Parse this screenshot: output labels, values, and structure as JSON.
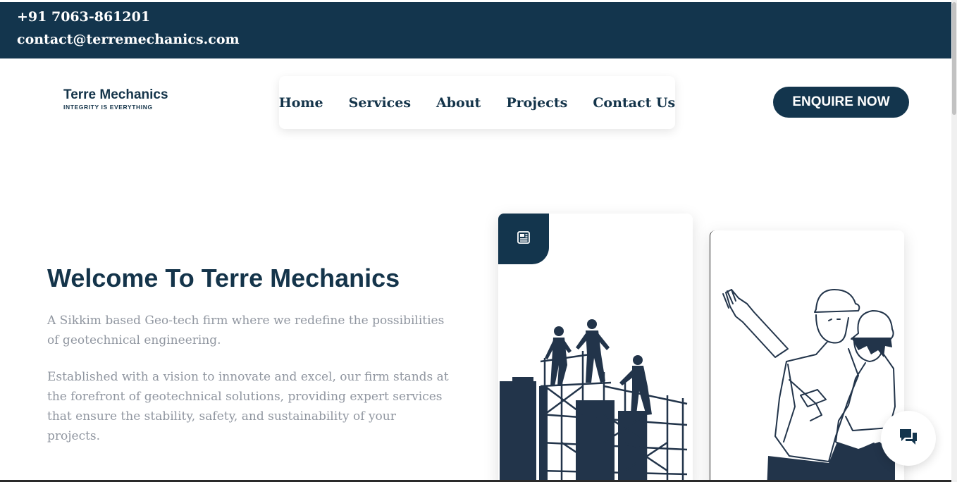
{
  "topbar": {
    "phone": "+91 7063-861201",
    "email": "contact@terremechanics.com"
  },
  "logo": {
    "name": "Terre Mechanics",
    "tagline": "Integrity is Everything"
  },
  "nav": {
    "items": [
      {
        "label": "Home"
      },
      {
        "label": "Services"
      },
      {
        "label": "About"
      },
      {
        "label": "Projects"
      },
      {
        "label": "Contact Us"
      }
    ]
  },
  "cta": {
    "label": "ENQUIRE NOW"
  },
  "hero": {
    "title": "Welcome To Terre Mechanics",
    "paragraph1": "A Sikkim based Geo-tech firm where we redefine the possibilities of geotechnical engineering.",
    "paragraph2": "Established with a vision to innovate and excel, our firm stands at the forefront of geotechnical solutions, providing expert services that ensure the stability, safety, and sustainability of your projects."
  },
  "icons": {
    "badge": "newspaper-icon",
    "chat": "chat-bubbles-icon"
  },
  "colors": {
    "primary": "#13354d",
    "text_muted": "#9096a0",
    "background": "#ffffff"
  }
}
